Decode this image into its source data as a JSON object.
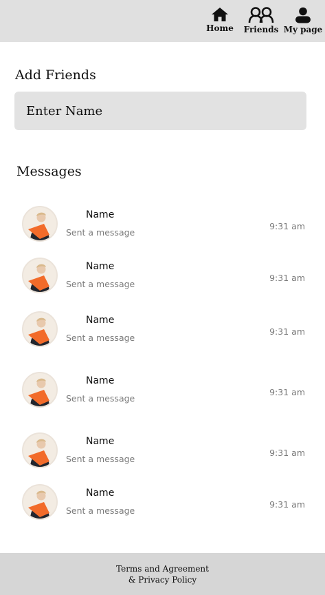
{
  "nav": {
    "items": [
      {
        "label": "Home",
        "icon": "home-icon"
      },
      {
        "label": "Friends",
        "icon": "friends-icon"
      },
      {
        "label": "My page",
        "icon": "user-icon"
      }
    ]
  },
  "add_friends": {
    "title": "Add Friends",
    "placeholder": "Enter Name"
  },
  "messages": {
    "title": "Messages",
    "items": [
      {
        "name": "Name",
        "preview": "Sent a message",
        "time": "9:31 am"
      },
      {
        "name": "Name",
        "preview": "Sent a message",
        "time": "9:31 am"
      },
      {
        "name": "Name",
        "preview": "Sent a message",
        "time": "9:31 am"
      },
      {
        "name": "Name",
        "preview": "Sent a message",
        "time": "9:31 am"
      },
      {
        "name": "Name",
        "preview": "Sent a message",
        "time": "9:31 am"
      },
      {
        "name": "Name",
        "preview": "Sent a message",
        "time": "9:31 am"
      }
    ]
  },
  "footer": {
    "line1": "Terms and Agreement",
    "line2": "& Privacy Policy"
  },
  "colors": {
    "topbar": "#e0e0e0",
    "input_bg": "#e2e2e2",
    "footer_bg": "#d6d6d6",
    "avatar_accent": "#f26b2a"
  }
}
